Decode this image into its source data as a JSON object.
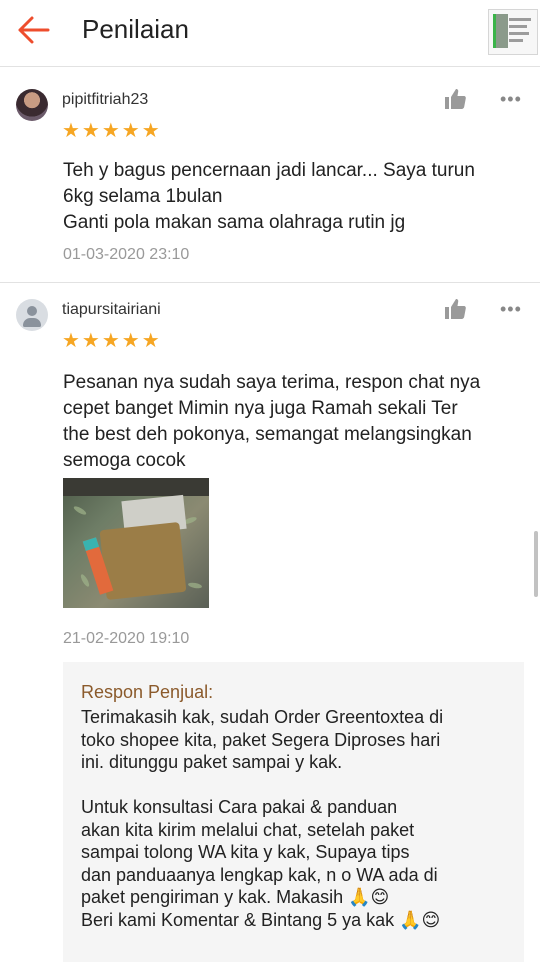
{
  "header": {
    "title": "Penilaian",
    "back_icon": "arrow-left-icon",
    "accent_color": "#ee4d2d"
  },
  "reviews": [
    {
      "username": "pipitfitriah23",
      "rating": 5,
      "stars": "★★★★★",
      "comment": "Teh y bagus pencernaan jadi lancar... Saya turun\n6kg selama 1bulan\nGanti pola makan sama olahraga rutin jg",
      "date": "01-03-2020 23:10"
    },
    {
      "username": "tiapursitairiani",
      "rating": 5,
      "stars": "★★★★★",
      "comment": "Pesanan nya sudah saya terima, respon chat nya\ncepet banget Mimin nya juga Ramah sekali Ter\nthe best deh pokonya, semangat melangsingkan\nsemoga cocok",
      "date": "21-02-2020 19:10",
      "seller_response": {
        "label": "Respon Penjual:",
        "text": "Terimakasih kak, sudah Order Greentoxtea di\ntoko shopee kita, paket Segera Diproses hari\nini. ditunggu paket sampai y kak.\n\nUntuk konsultasi Cara pakai & panduan\nakan kita kirim melalui chat, setelah paket\nsampai tolong WA kita y kak, Supaya tips\ndan panduaanya lengkap kak, n o WA ada di\npaket pengiriman y kak. Makasih 🙏😊\nBeri kami Komentar & Bintang 5 ya kak 🙏😊"
      }
    }
  ],
  "colors": {
    "star": "#f6a623",
    "seller_label": "#8b5a2b",
    "date": "#999999"
  }
}
